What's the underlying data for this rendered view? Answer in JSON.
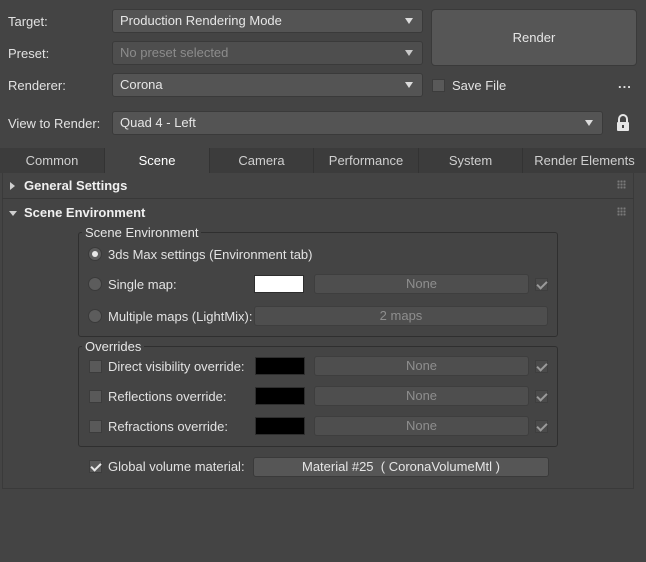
{
  "header": {
    "target": {
      "label": "Target:",
      "value": "Production Rendering Mode"
    },
    "preset": {
      "label": "Preset:",
      "value": "No preset selected"
    },
    "renderer": {
      "label": "Renderer:",
      "value": "Corona"
    },
    "view": {
      "label": "View to Render:",
      "value": "Quad 4 - Left"
    },
    "render_button": "Render",
    "save_file": {
      "label": "Save File",
      "checked": false
    },
    "more_button": "..."
  },
  "tabs": [
    "Common",
    "Scene",
    "Camera",
    "Performance",
    "System",
    "Render Elements"
  ],
  "active_tab": "Scene",
  "rollouts": {
    "general": "General Settings",
    "scene_env": "Scene Environment"
  },
  "scene_env_group": {
    "title": "Scene Environment",
    "option_max": "3ds Max settings (Environment tab)",
    "option_single": "Single map:",
    "single_map_button": "None",
    "single_map_color": "#ffffff",
    "option_multi": "Multiple maps (LightMix):",
    "multi_maps_button": "2 maps"
  },
  "overrides_group": {
    "title": "Overrides",
    "direct": {
      "label": "Direct visibility override:",
      "map": "None",
      "color": "#000000"
    },
    "reflections": {
      "label": "Reflections override:",
      "map": "None",
      "color": "#000000"
    },
    "refractions": {
      "label": "Refractions override:",
      "map": "None",
      "color": "#000000"
    }
  },
  "volume": {
    "label": "Global volume material:",
    "checked": true,
    "material_button": "Material #25  ( CoronaVolumeMtl )"
  },
  "colors": {
    "background": "#444444",
    "tab_bar": "#3c3c3c",
    "text": "#e2e2e2",
    "disabled_text": "#8c8c8c"
  }
}
